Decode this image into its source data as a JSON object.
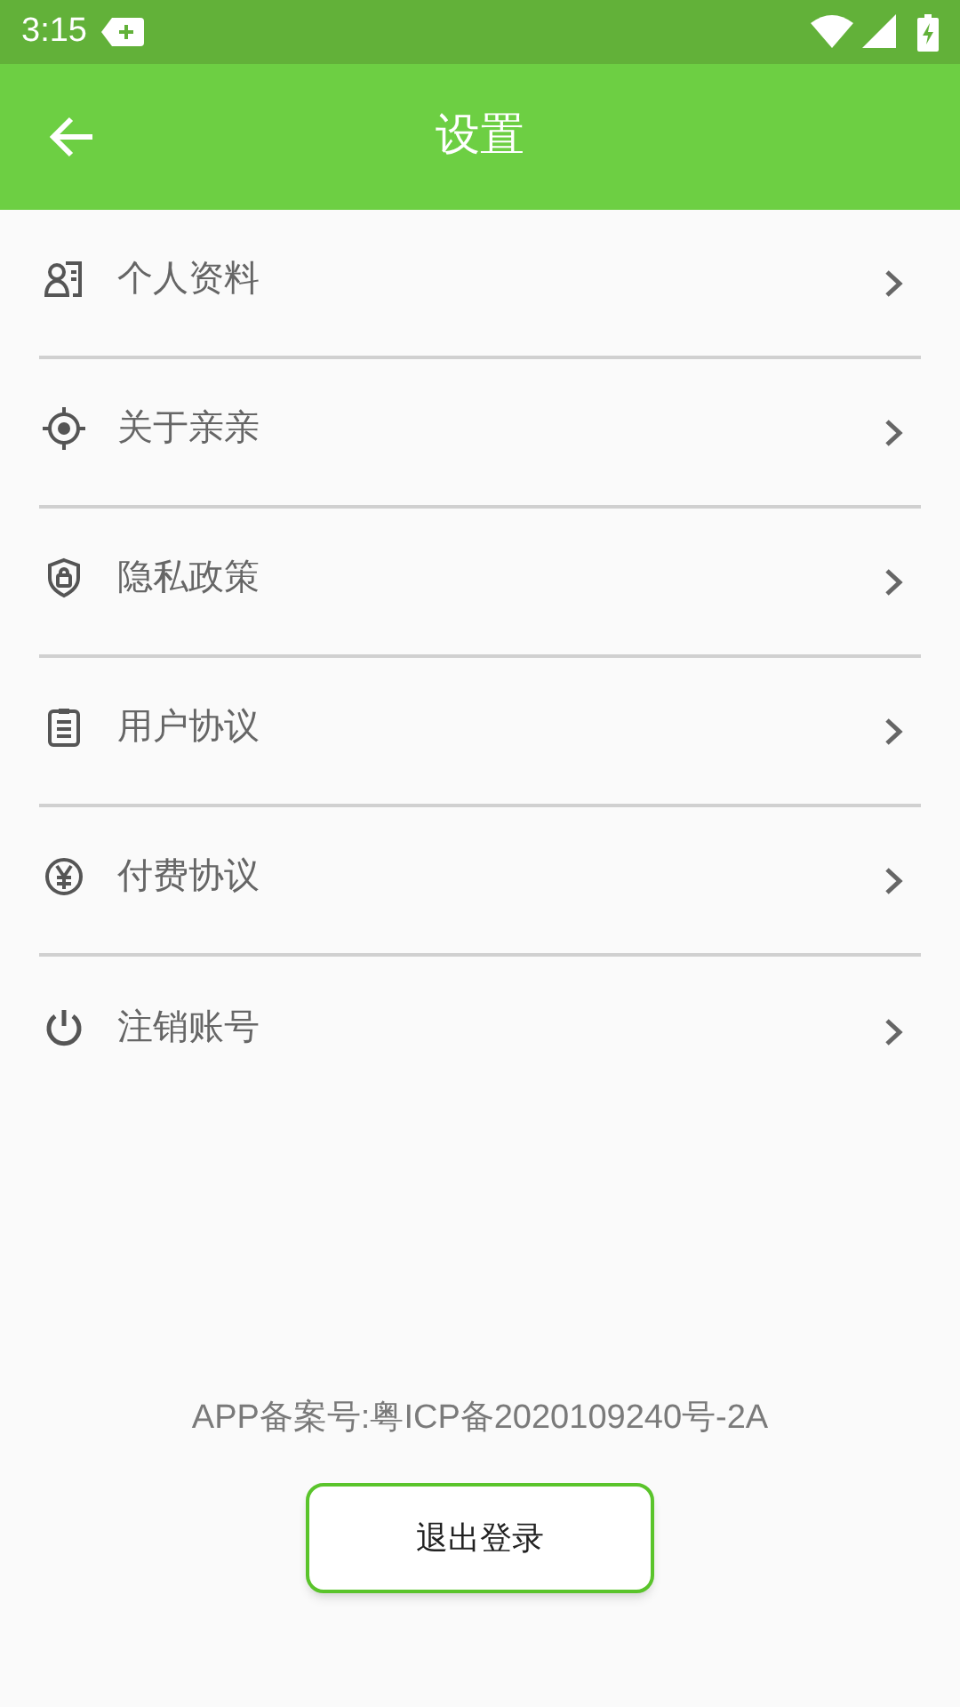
{
  "status_bar": {
    "time": "3:15"
  },
  "toolbar": {
    "title": "设置"
  },
  "menu": [
    {
      "kind": "profile",
      "label": "个人资料"
    },
    {
      "kind": "about",
      "label": "关于亲亲"
    },
    {
      "kind": "privacy",
      "label": "隐私政策"
    },
    {
      "kind": "agreement",
      "label": "用户协议"
    },
    {
      "kind": "payment",
      "label": "付费协议"
    },
    {
      "kind": "cancel",
      "label": "注销账号"
    }
  ],
  "footer": {
    "record": "APP备案号:粤ICP备2020109240号-2A",
    "logout_button": "退出登录"
  }
}
